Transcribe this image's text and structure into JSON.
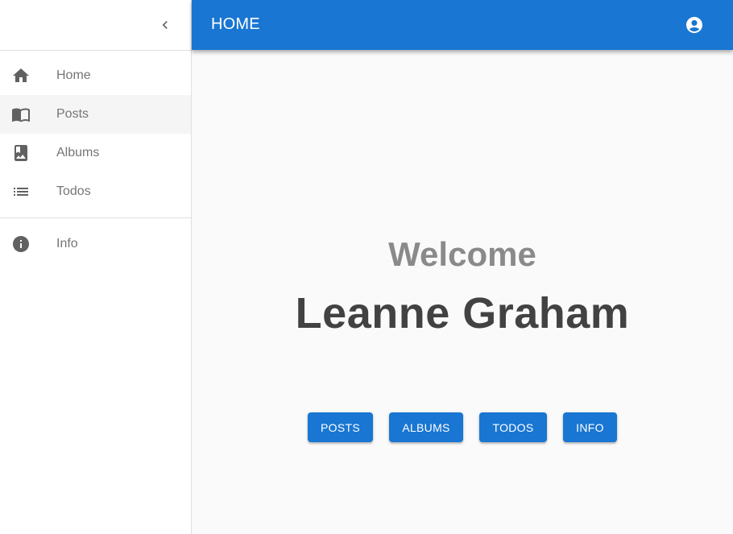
{
  "appbar": {
    "title": "HOME",
    "account_icon": "account-circle-icon"
  },
  "sidebar": {
    "collapse_icon": "chevron-left-icon",
    "items": [
      {
        "label": "Home",
        "icon": "home-icon"
      },
      {
        "label": "Posts",
        "icon": "book-open-icon"
      },
      {
        "label": "Albums",
        "icon": "photo-album-icon"
      },
      {
        "label": "Todos",
        "icon": "list-icon"
      }
    ],
    "secondary_items": [
      {
        "label": "Info",
        "icon": "info-icon"
      }
    ],
    "active_item": "Posts"
  },
  "main": {
    "welcome": "Welcome",
    "user_name": "Leanne Graham",
    "buttons": {
      "posts": "POSTS",
      "albums": "ALBUMS",
      "todos": "TODOS",
      "info": "INFO"
    }
  },
  "colors": {
    "primary": "#1976d2",
    "icon": "#616161",
    "text_muted": "#757575",
    "heading": "#424242"
  }
}
